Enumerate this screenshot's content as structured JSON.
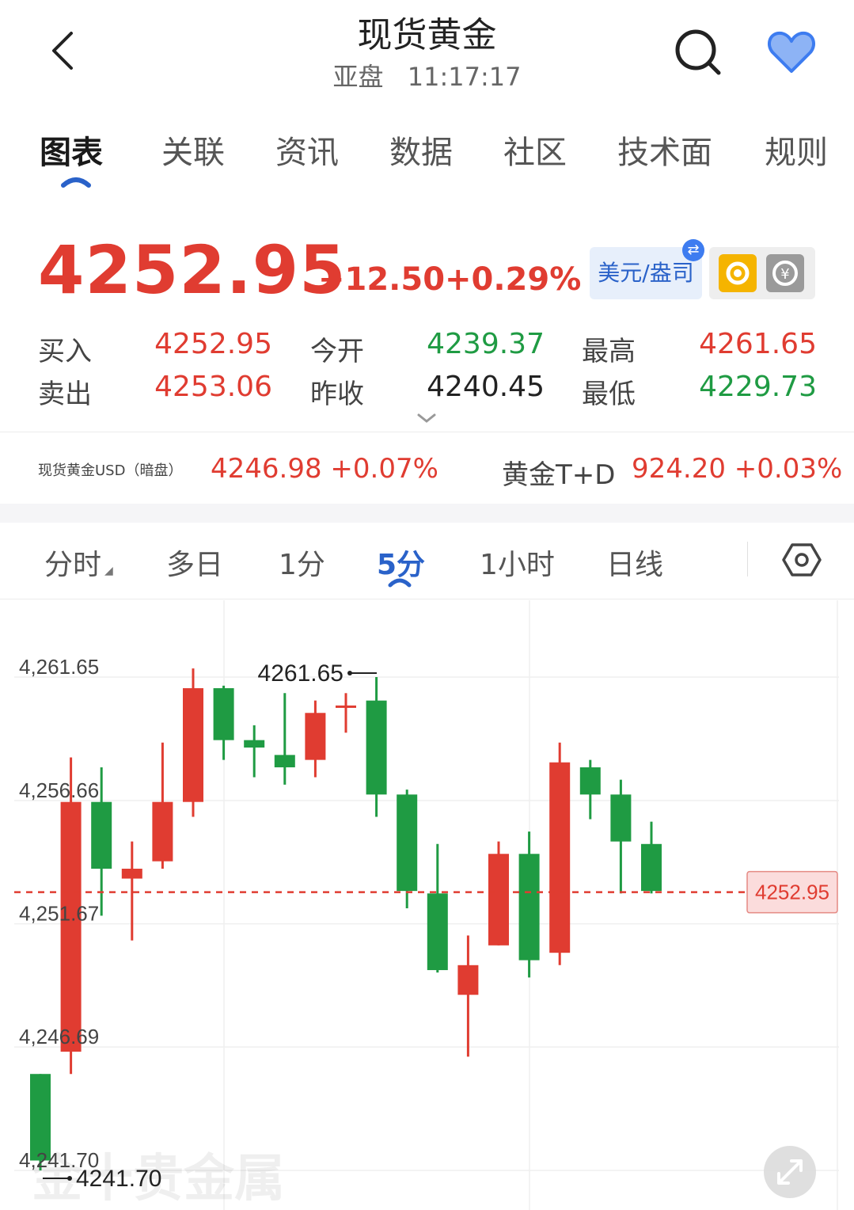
{
  "header": {
    "title": "现货黄金",
    "session": "亚盘",
    "time": "11:17:17"
  },
  "tabs": [
    {
      "label": "图表",
      "active": true
    },
    {
      "label": "关联",
      "active": false
    },
    {
      "label": "资讯",
      "active": false
    },
    {
      "label": "数据",
      "active": false
    },
    {
      "label": "社区",
      "active": false
    },
    {
      "label": "技术面",
      "active": false
    },
    {
      "label": "规则",
      "active": false
    }
  ],
  "quote": {
    "price": "4252.95",
    "change": "+12.50",
    "change_pct": "+0.29%",
    "unit_label": "美元/盎司",
    "bid_label": "买入",
    "bid": "4252.95",
    "ask_label": "卖出",
    "ask": "4253.06",
    "open_label": "今开",
    "open": "4239.37",
    "prev_close_label": "昨收",
    "prev_close": "4240.45",
    "high_label": "最高",
    "high": "4261.65",
    "low_label": "最低",
    "low": "4229.73"
  },
  "related": [
    {
      "name": "现货黄金USD（暗盘）",
      "value": "4246.98 +0.07%"
    },
    {
      "name": "黄金T+D",
      "value": "924.20 +0.03%"
    }
  ],
  "periods": [
    {
      "label": "分时",
      "active": false
    },
    {
      "label": "多日",
      "active": false
    },
    {
      "label": "1分",
      "active": false
    },
    {
      "label": "5分",
      "active": true
    },
    {
      "label": "1小时",
      "active": false
    },
    {
      "label": "日线",
      "active": false
    }
  ],
  "colors": {
    "up": "#e03c31",
    "down": "#1f9b43",
    "accent": "#2a62c9"
  },
  "icons": {
    "back": "chevron-left-icon",
    "search": "search-icon",
    "favorite": "heart-icon",
    "settings": "hexagon-settings-icon",
    "expand": "expand-icon",
    "refresh": "refresh-icon",
    "calculator": "calculator-icon",
    "swap": "swap-icon"
  },
  "chart_data": {
    "type": "candlestick",
    "y_ticks": [
      "4,261.65",
      "4,256.66",
      "4,251.67",
      "4,246.69",
      "4,241.70"
    ],
    "ylim": [
      4240.7,
      4264.0
    ],
    "high_label": "4261.65",
    "low_label": "4241.70",
    "current_price_label": "4252.95",
    "watermark": "金十贵金属",
    "candles": [
      {
        "o": 4245.6,
        "h": 4245.6,
        "l": 4241.7,
        "c": 4242.1
      },
      {
        "o": 4246.5,
        "h": 4258.4,
        "l": 4245.6,
        "c": 4256.6
      },
      {
        "o": 4256.6,
        "h": 4258.0,
        "l": 4252.0,
        "c": 4253.9
      },
      {
        "o": 4253.5,
        "h": 4255.0,
        "l": 4251.0,
        "c": 4253.9
      },
      {
        "o": 4254.2,
        "h": 4259.0,
        "l": 4253.9,
        "c": 4256.6
      },
      {
        "o": 4256.6,
        "h": 4262.0,
        "l": 4256.0,
        "c": 4261.2
      },
      {
        "o": 4261.2,
        "h": 4261.3,
        "l": 4258.3,
        "c": 4259.1
      },
      {
        "o": 4259.1,
        "h": 4259.7,
        "l": 4257.6,
        "c": 4258.8
      },
      {
        "o": 4258.5,
        "h": 4261.0,
        "l": 4257.3,
        "c": 4258.0
      },
      {
        "o": 4258.3,
        "h": 4260.7,
        "l": 4257.6,
        "c": 4260.2
      },
      {
        "o": 4260.5,
        "h": 4261.0,
        "l": 4259.4,
        "c": 4260.5
      },
      {
        "o": 4260.7,
        "h": 4261.65,
        "l": 4256.0,
        "c": 4256.9
      },
      {
        "o": 4256.9,
        "h": 4257.1,
        "l": 4252.3,
        "c": 4253.0
      },
      {
        "o": 4252.9,
        "h": 4254.9,
        "l": 4249.7,
        "c": 4249.8
      },
      {
        "o": 4248.8,
        "h": 4251.2,
        "l": 4246.3,
        "c": 4250.0
      },
      {
        "o": 4250.8,
        "h": 4255.0,
        "l": 4250.8,
        "c": 4254.5
      },
      {
        "o": 4254.5,
        "h": 4255.4,
        "l": 4249.5,
        "c": 4250.2
      },
      {
        "o": 4250.5,
        "h": 4259.0,
        "l": 4250.0,
        "c": 4258.2
      },
      {
        "o": 4258.0,
        "h": 4258.3,
        "l": 4255.9,
        "c": 4256.9
      },
      {
        "o": 4256.9,
        "h": 4257.5,
        "l": 4252.9,
        "c": 4255.0
      },
      {
        "o": 4254.9,
        "h": 4255.8,
        "l": 4252.9,
        "c": 4253.0
      }
    ]
  }
}
